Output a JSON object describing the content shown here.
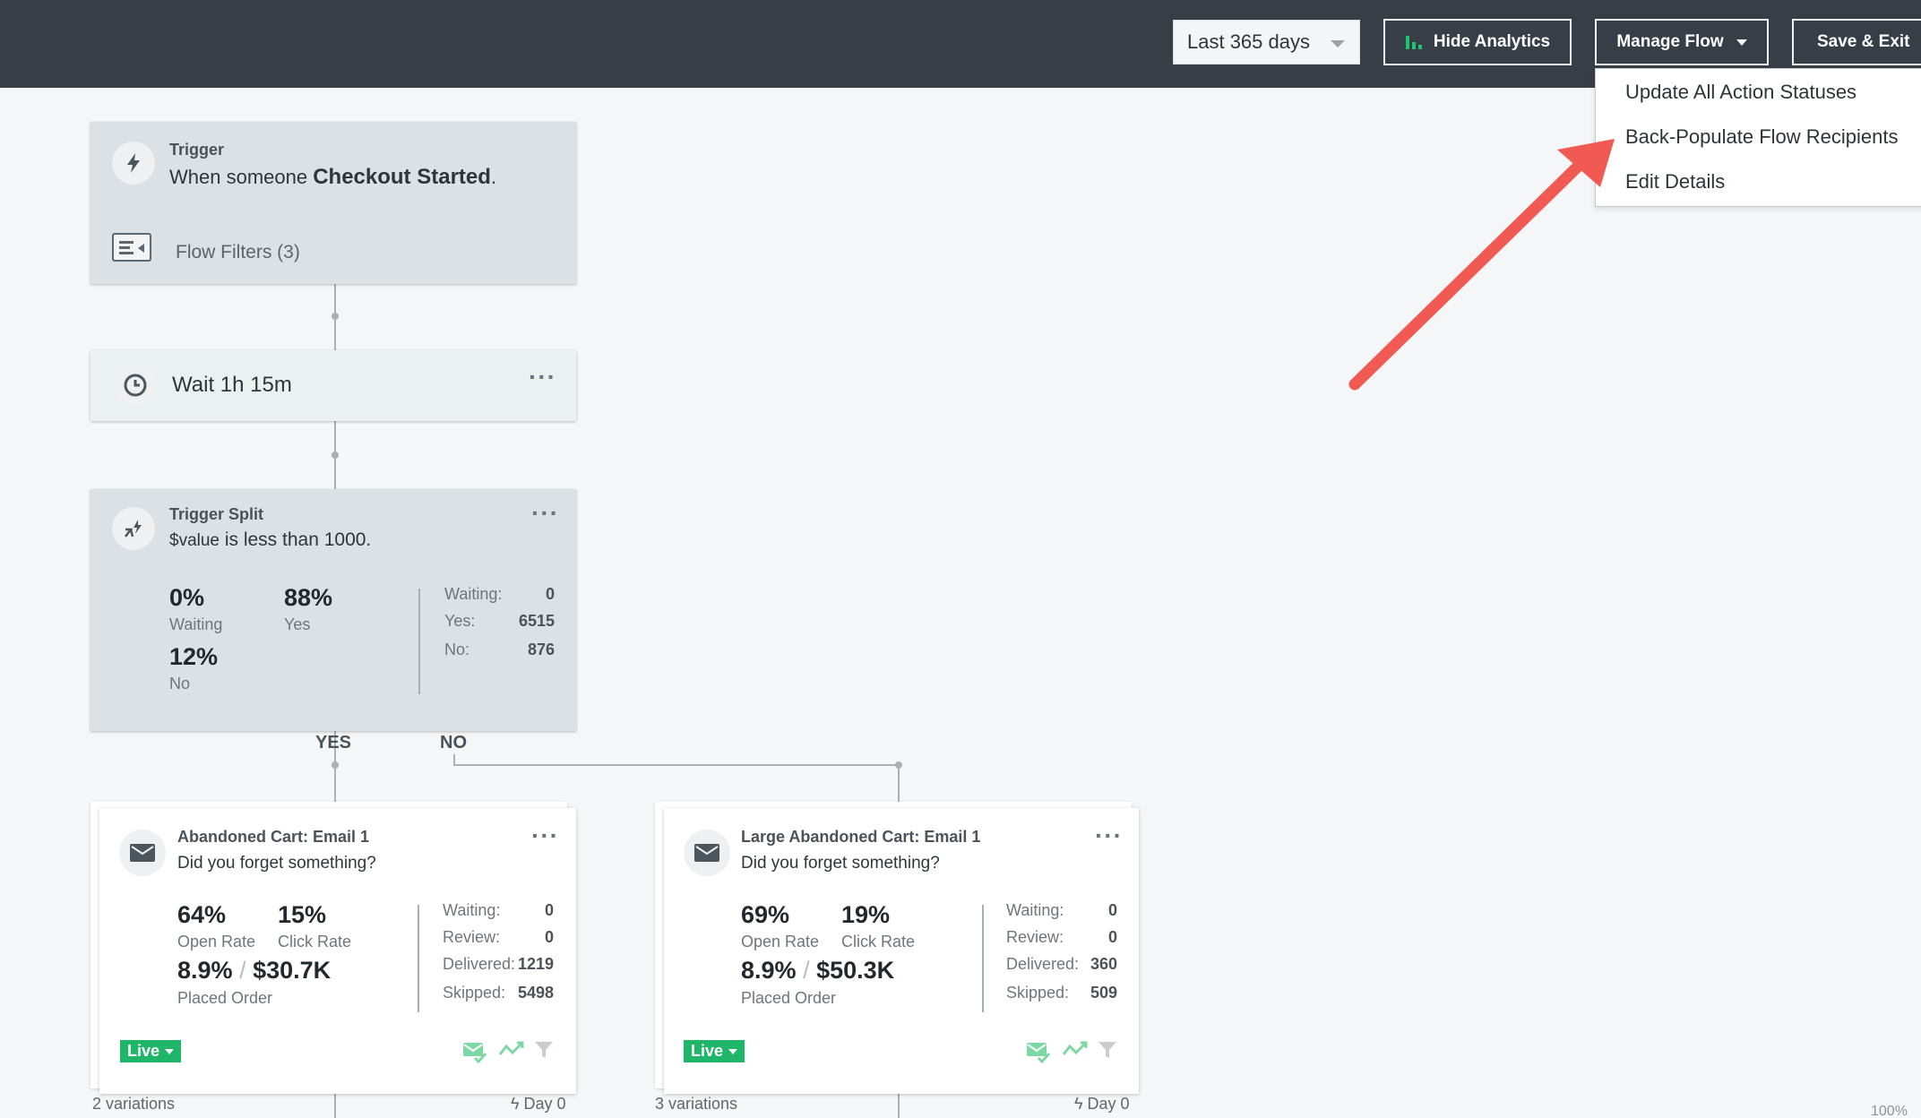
{
  "topbar": {
    "date_range": "Last 365 days",
    "hide_analytics": "Hide Analytics",
    "manage_flow": "Manage Flow",
    "save_exit": "Save & Exit"
  },
  "manage_menu": {
    "items": [
      "Update All Action Statuses",
      "Back-Populate Flow Recipients",
      "Edit Details"
    ]
  },
  "trigger": {
    "label": "Trigger",
    "prefix": "When someone ",
    "metric": "Checkout Started",
    "suffix": ".",
    "filters": "Flow Filters (3)"
  },
  "wait": {
    "label": "Wait 1h 15m"
  },
  "split": {
    "label": "Trigger Split",
    "var": "$value",
    "condition": " is less than 1000.",
    "waiting_pct": "0%",
    "waiting_lbl": "Waiting",
    "yes_pct": "88%",
    "yes_lbl": "Yes",
    "no_pct": "12%",
    "no_lbl": "No",
    "stats": [
      {
        "k": "Waiting:",
        "v": "0"
      },
      {
        "k": "Yes:",
        "v": "6515"
      },
      {
        "k": "No:",
        "v": "876"
      }
    ],
    "yes_branch": "YES",
    "no_branch": "NO"
  },
  "emails": [
    {
      "title": "Abandoned Cart: Email 1",
      "subject": "Did you forget something?",
      "open_rate": "64%",
      "open_lbl": "Open Rate",
      "click_rate": "15%",
      "click_lbl": "Click Rate",
      "placed_pct": "8.9%",
      "slash": "/",
      "revenue": "$30.7K",
      "placed_lbl": "Placed Order",
      "stats": [
        {
          "k": "Waiting:",
          "v": "0"
        },
        {
          "k": "Review:",
          "v": "0"
        },
        {
          "k": "Delivered:",
          "v": "1219"
        },
        {
          "k": "Skipped:",
          "v": "5498"
        }
      ],
      "status": "Live",
      "variations": "2 variations",
      "day": "Day 0"
    },
    {
      "title": "Large Abandoned Cart: Email 1",
      "subject": "Did you forget something?",
      "open_rate": "69%",
      "open_lbl": "Open Rate",
      "click_rate": "19%",
      "click_lbl": "Click Rate",
      "placed_pct": "8.9%",
      "slash": "/",
      "revenue": "$50.3K",
      "placed_lbl": "Placed Order",
      "stats": [
        {
          "k": "Waiting:",
          "v": "0"
        },
        {
          "k": "Review:",
          "v": "0"
        },
        {
          "k": "Delivered:",
          "v": "360"
        },
        {
          "k": "Skipped:",
          "v": "509"
        }
      ],
      "status": "Live",
      "variations": "3 variations",
      "day": "Day 0"
    }
  ],
  "zoom": "100%",
  "colors": {
    "topbar": "#373e45",
    "live": "#1fb66a",
    "arrow": "#f05a52",
    "node": "#dce1e6"
  }
}
